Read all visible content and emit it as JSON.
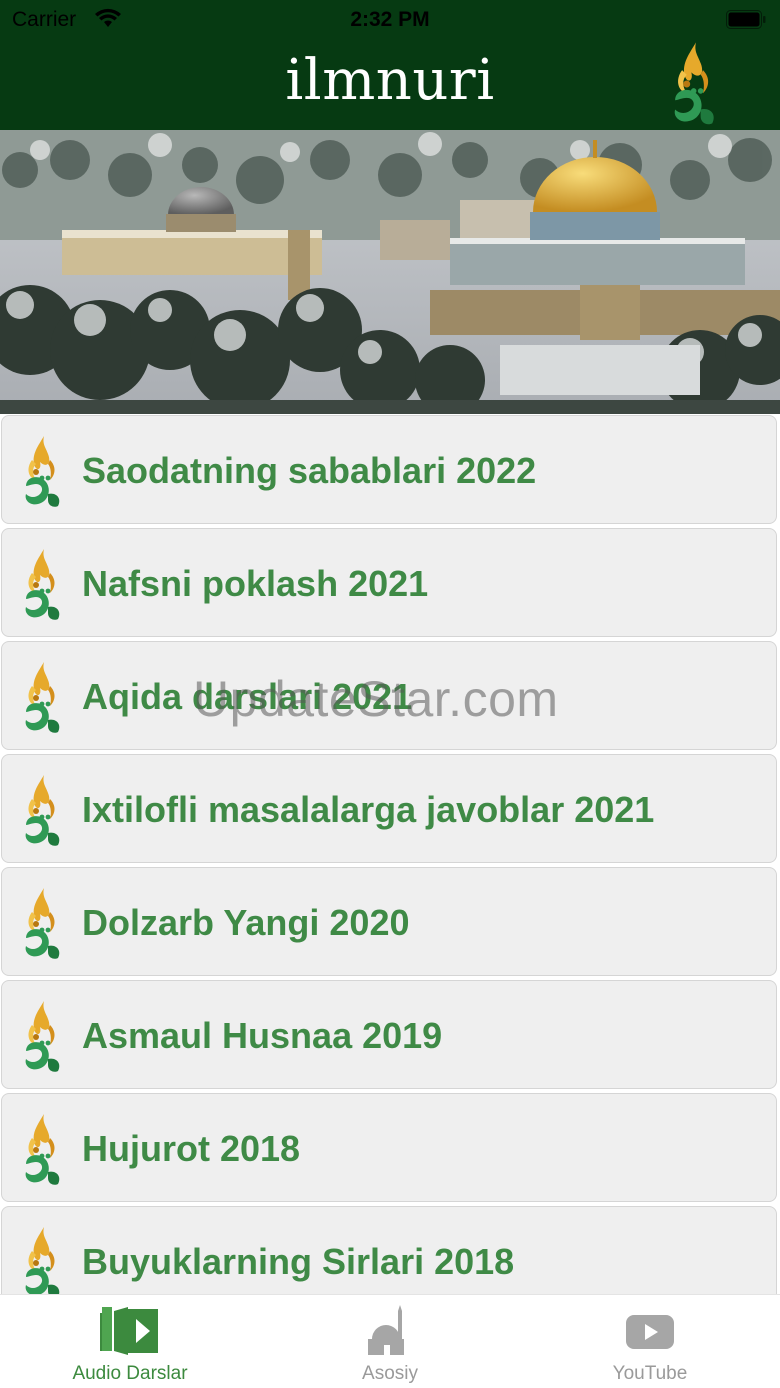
{
  "status_bar": {
    "carrier": "Carrier",
    "time": "2:32 PM"
  },
  "nav": {
    "title": "ilmnuri"
  },
  "list": {
    "items": [
      {
        "label": "Saodatning sabablari 2022"
      },
      {
        "label": "Nafsni poklash 2021"
      },
      {
        "label": "Aqida darslari 2021"
      },
      {
        "label": "Ixtilofli masalalarga javoblar 2021"
      },
      {
        "label": "Dolzarb Yangi 2020"
      },
      {
        "label": "Asmaul Husnaa 2019"
      },
      {
        "label": "Hujurot 2018"
      },
      {
        "label": "Buyuklarning Sirlari 2018"
      }
    ]
  },
  "watermark": "UpdateStar.com",
  "tabs": [
    {
      "label": "Audio Darslar",
      "icon": "book-play-icon",
      "active": true
    },
    {
      "label": "Asosiy",
      "icon": "mosque-icon",
      "active": false
    },
    {
      "label": "YouTube",
      "icon": "youtube-icon",
      "active": false
    }
  ],
  "colors": {
    "header_bg": "#063a12",
    "item_text": "#3f8a46",
    "tab_active": "#3c8a3e",
    "tab_inactive": "#9a9a9a"
  }
}
